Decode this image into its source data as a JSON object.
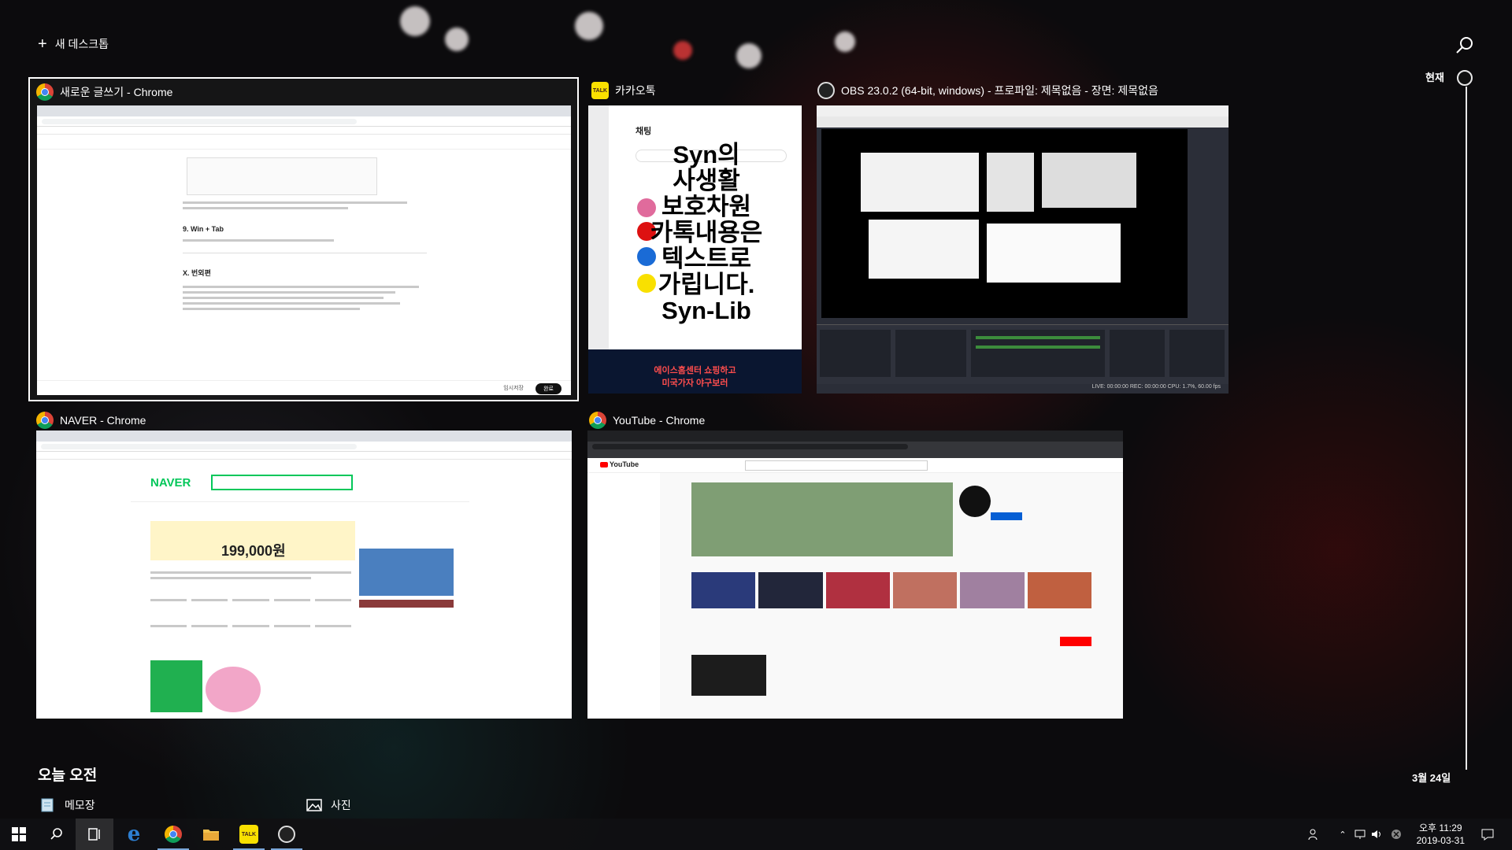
{
  "new_desktop": {
    "label": "새 데스크톱"
  },
  "timeline": {
    "current_label": "현재",
    "date_label": "3월 24일"
  },
  "windows": {
    "writer": {
      "title": "새로운 글쓰기 - Chrome",
      "app": "chrome-icon",
      "doc_heading_1": "9. Win + Tab",
      "doc_heading_2": "X. 번외편",
      "footer_buttons": [
        "임시저장",
        "완료"
      ]
    },
    "kakao": {
      "title": "카카오톡",
      "app": "kakaotalk-icon",
      "panel_title": "채팅",
      "overlay_lines": [
        "Syn의",
        "사생활",
        "보호차원",
        "카톡내용은",
        "텍스트로",
        "가립니다.",
        "Syn-Lib"
      ],
      "ad_line_1": "에이스홈센터 쇼핑하고",
      "ad_line_2": "미국가자 야구보러"
    },
    "obs": {
      "title": "OBS 23.0.2 (64-bit, windows) - 프로파일: 제목없음 - 장면: 제목없음",
      "app": "obs-icon",
      "status": "LIVE: 00:00:00    REC: 00:00:00    CPU: 1.7%, 60.00 fps"
    },
    "naver": {
      "title": "NAVER - Chrome",
      "app": "chrome-icon",
      "logo": "NAVER",
      "ad_price": "199,000원"
    },
    "youtube": {
      "title": "YouTube - Chrome",
      "app": "chrome-icon",
      "logo": "YouTube"
    }
  },
  "section_title": "오늘 오전",
  "recent_activities": [
    {
      "label": "메모장",
      "icon": "notepad-icon"
    },
    {
      "label": "사진",
      "icon": "photos-icon"
    }
  ],
  "taskbar": {
    "items": [
      "start-icon",
      "search-icon",
      "task-view-icon",
      "edge-icon",
      "chrome-icon",
      "file-explorer-icon",
      "kakaotalk-icon",
      "obs-icon"
    ],
    "clock_time": "오후 11:29",
    "clock_date": "2019-03-31"
  },
  "colors": {
    "accent": "#7aa7d8",
    "kakao_yellow": "#f9e000",
    "naver_green": "#03c75a",
    "youtube_red": "#ff0000"
  }
}
